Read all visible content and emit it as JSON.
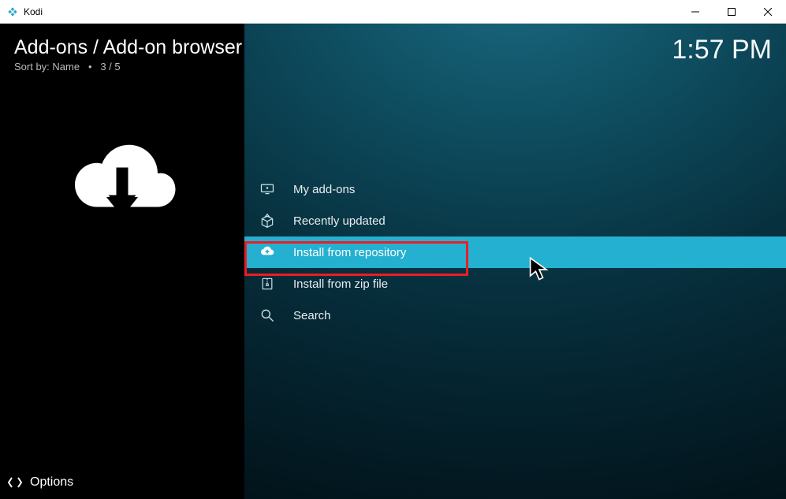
{
  "window": {
    "title": "Kodi"
  },
  "header": {
    "breadcrumb": "Add-ons / Add-on browser",
    "sort_label": "Sort by: Name",
    "position": "3 / 5",
    "clock": "1:57 PM"
  },
  "menu": {
    "items": [
      {
        "label": "My add-ons",
        "icon": "screen-icon",
        "selected": false
      },
      {
        "label": "Recently updated",
        "icon": "box-open-icon",
        "selected": false
      },
      {
        "label": "Install from repository",
        "icon": "cloud-plus-icon",
        "selected": true
      },
      {
        "label": "Install from zip file",
        "icon": "zip-icon",
        "selected": false
      },
      {
        "label": "Search",
        "icon": "search-icon",
        "selected": false
      }
    ]
  },
  "footer": {
    "options_label": "Options"
  }
}
